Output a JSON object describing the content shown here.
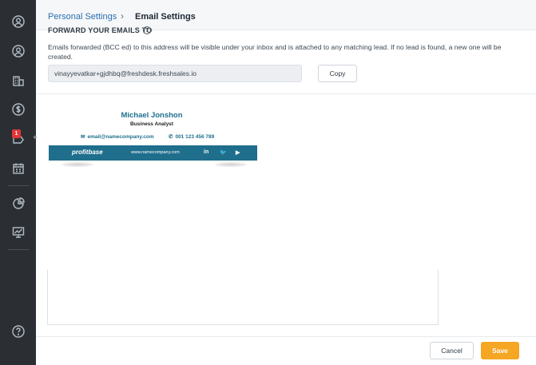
{
  "breadcrumb": {
    "parent": "Personal Settings",
    "separator": "›",
    "current": "Email Settings"
  },
  "forward": {
    "heading": "FORWARD YOUR EMAILS TO",
    "info": "?",
    "description": "Emails forwarded (BCC ed) to this address will be visible under your inbox and is attached to any matching lead. If no lead is found, a new one will be created.",
    "address": "vinayyevatkar+gjdhbq@freshdesk.freshsales.io",
    "copy_label": "Copy"
  },
  "signature": {
    "name": "Michael Jonshon",
    "role": "Business Analyst",
    "email": "email@namecompany.com",
    "phone": "001 123 456 789",
    "logo": "profitbase",
    "website": "www.namecompany.com",
    "social": {
      "linkedin": "in",
      "twitter": "🐦",
      "youtube": "▶"
    },
    "brand_color": "#1f6e8c"
  },
  "sidebar": {
    "notification_count": "1"
  },
  "footer": {
    "cancel_label": "Cancel",
    "save_label": "Save"
  },
  "colors": {
    "accent": "#f5a623",
    "sidebar": "#2b2f33",
    "link": "#2a6fb0"
  }
}
